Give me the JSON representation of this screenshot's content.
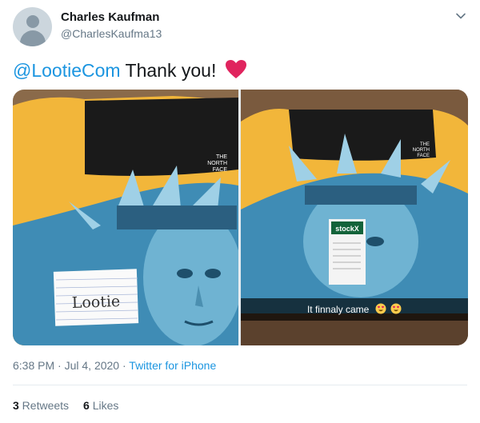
{
  "user": {
    "name": "Charles Kaufman",
    "handle": "@CharlesKaufma13"
  },
  "tweet": {
    "mention": "@LootieCom",
    "text": " Thank you!",
    "heart_emoji": "red-heart-icon"
  },
  "media": {
    "left_photo_note": "Lootie",
    "right_photo_tag": "stockX",
    "right_photo_jacket_logo": "THE NORTH FACE",
    "right_photo_caption": "It finnaly came"
  },
  "meta": {
    "time": "6:38 PM",
    "separator": " · ",
    "date": "Jul 4, 2020",
    "source": "Twitter for iPhone"
  },
  "stats": {
    "retweets_count": "3",
    "retweets_label": " Retweets",
    "likes_count": "6",
    "likes_label": " Likes"
  },
  "colors": {
    "link": "#1b95e0",
    "secondary_text": "#657786",
    "heart": "#e0245e",
    "jacket_yellow": "#f2b63a"
  }
}
